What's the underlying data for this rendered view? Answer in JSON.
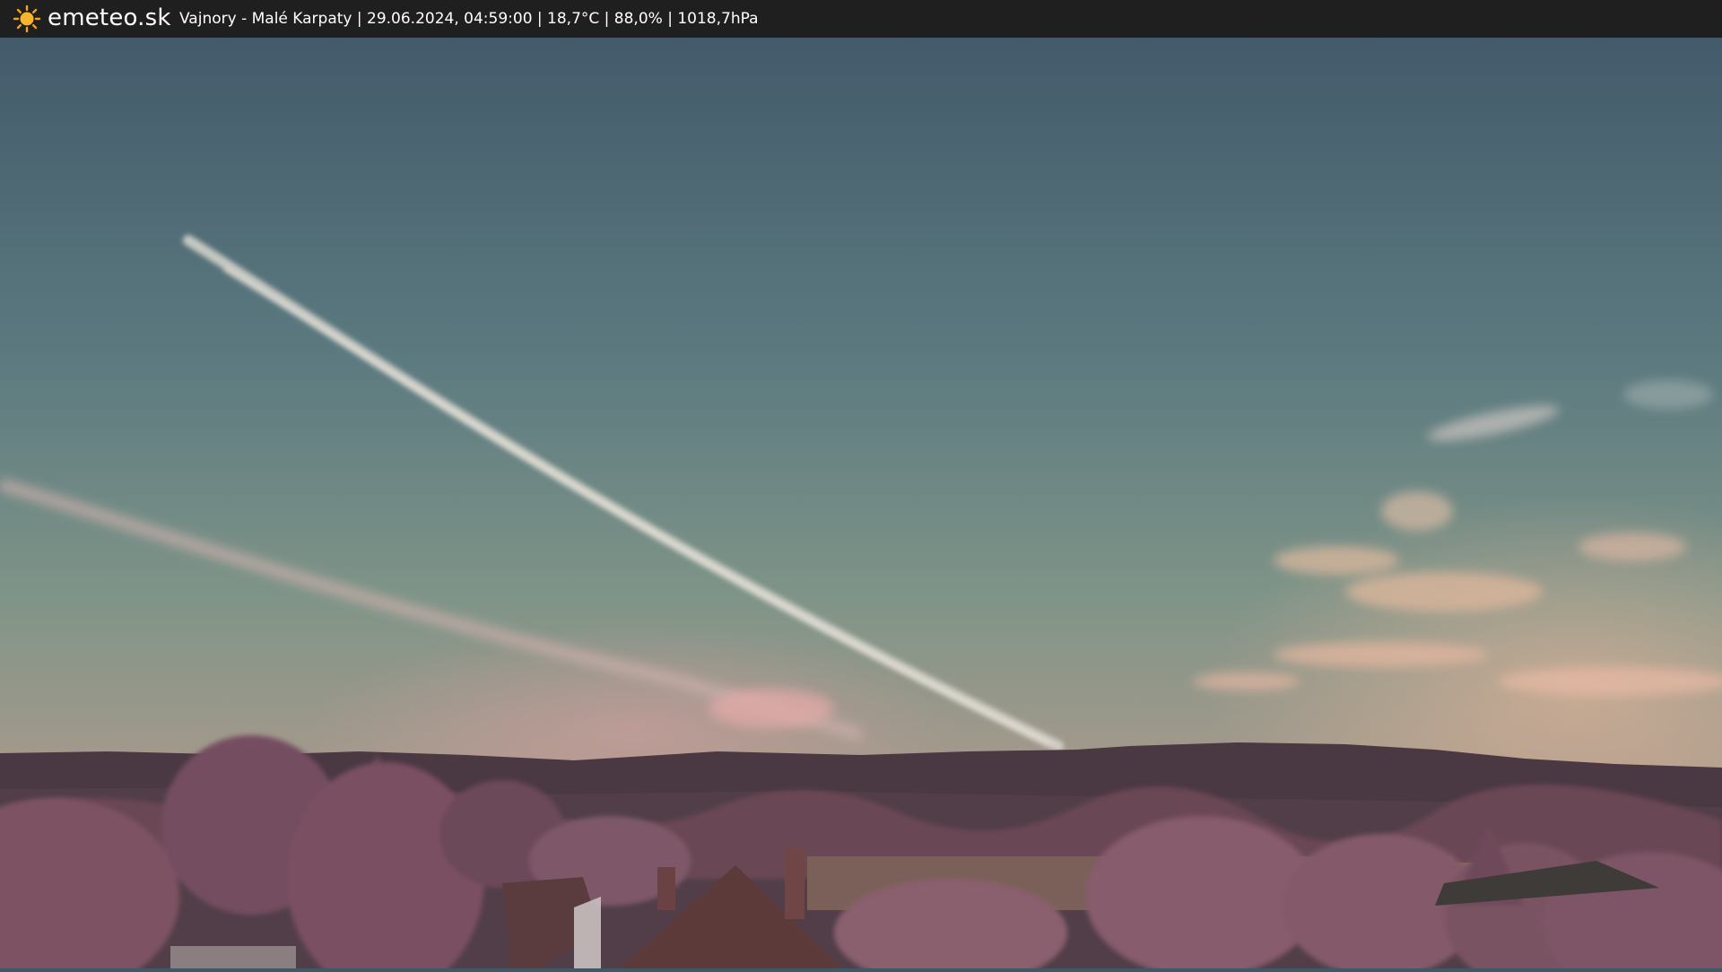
{
  "overlay": {
    "brand": "emeteo.sk",
    "status_line": "Vajnory - Malé Karpaty | 29.06.2024, 04:59:00 | 18,7°C | 88,0% | 1018,7hPa",
    "logo_icon": "sun-icon"
  },
  "colors": {
    "bar_background": "#1f1f1f",
    "sun": "#f6a21a",
    "sky_top": "#475e6e",
    "sky_mid": "#6a8a88",
    "sky_horizon": "#c4a298",
    "hills": "#4a3840",
    "foliage": "#8a5c6c"
  }
}
